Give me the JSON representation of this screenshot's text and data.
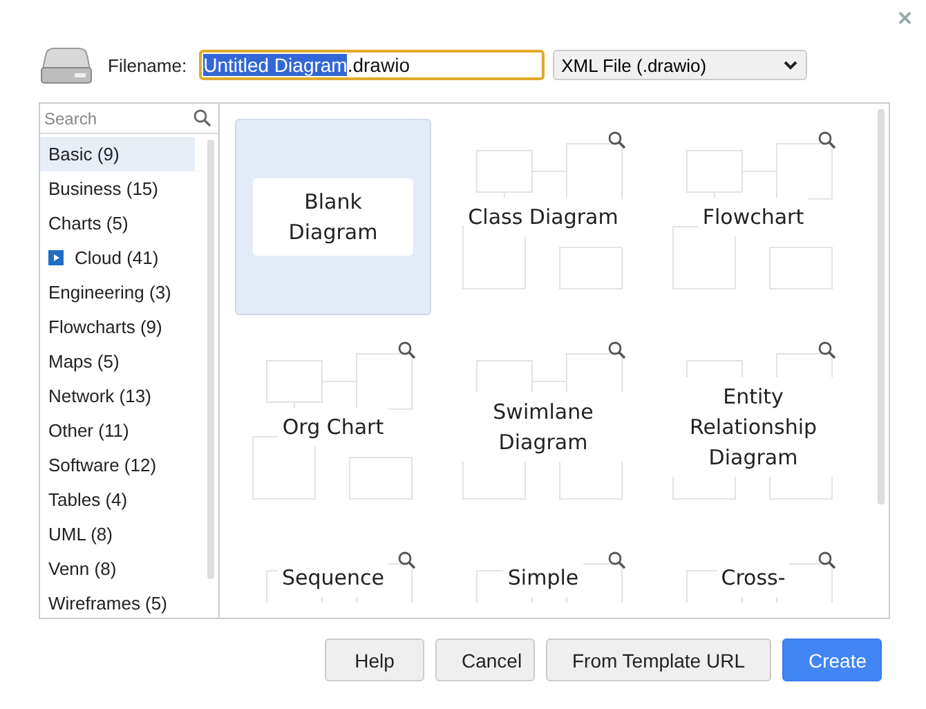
{
  "dialog": {
    "close": "×"
  },
  "filename": {
    "label": "Filename:",
    "selected_text": "Untitled Diagram",
    "rest_text": ".drawio"
  },
  "format_select": {
    "value": "XML File (.drawio)"
  },
  "search": {
    "placeholder": "Search"
  },
  "categories": [
    {
      "label": "Basic (9)",
      "selected": true,
      "has_icon": false
    },
    {
      "label": "Business (15)",
      "selected": false,
      "has_icon": false
    },
    {
      "label": "Charts (5)",
      "selected": false,
      "has_icon": false
    },
    {
      "label": "Cloud (41)",
      "selected": false,
      "has_icon": true
    },
    {
      "label": "Engineering (3)",
      "selected": false,
      "has_icon": false
    },
    {
      "label": "Flowcharts (9)",
      "selected": false,
      "has_icon": false
    },
    {
      "label": "Maps (5)",
      "selected": false,
      "has_icon": false
    },
    {
      "label": "Network (13)",
      "selected": false,
      "has_icon": false
    },
    {
      "label": "Other (11)",
      "selected": false,
      "has_icon": false
    },
    {
      "label": "Software (12)",
      "selected": false,
      "has_icon": false
    },
    {
      "label": "Tables (4)",
      "selected": false,
      "has_icon": false
    },
    {
      "label": "UML (8)",
      "selected": false,
      "has_icon": false
    },
    {
      "label": "Venn (8)",
      "selected": false,
      "has_icon": false
    },
    {
      "label": "Wireframes (5)",
      "selected": false,
      "has_icon": false
    }
  ],
  "templates": [
    {
      "title": "Blank Diagram",
      "selected": true,
      "has_preview": false
    },
    {
      "title": "Class Diagram",
      "selected": false,
      "has_preview": true
    },
    {
      "title": "Flowchart",
      "selected": false,
      "has_preview": true
    },
    {
      "title": "Org Chart",
      "selected": false,
      "has_preview": true
    },
    {
      "title": "Swimlane Diagram",
      "selected": false,
      "has_preview": true
    },
    {
      "title": "Entity Relationship Diagram",
      "selected": false,
      "has_preview": true
    },
    {
      "title": "Sequence",
      "selected": false,
      "has_preview": true
    },
    {
      "title": "Simple",
      "selected": false,
      "has_preview": true
    },
    {
      "title": "Cross-",
      "selected": false,
      "has_preview": true
    }
  ],
  "buttons": [
    {
      "label": "Help",
      "kind": "default"
    },
    {
      "label": "Cancel",
      "kind": "default"
    },
    {
      "label": "From Template URL",
      "kind": "default"
    },
    {
      "label": "Create",
      "kind": "primary"
    }
  ]
}
